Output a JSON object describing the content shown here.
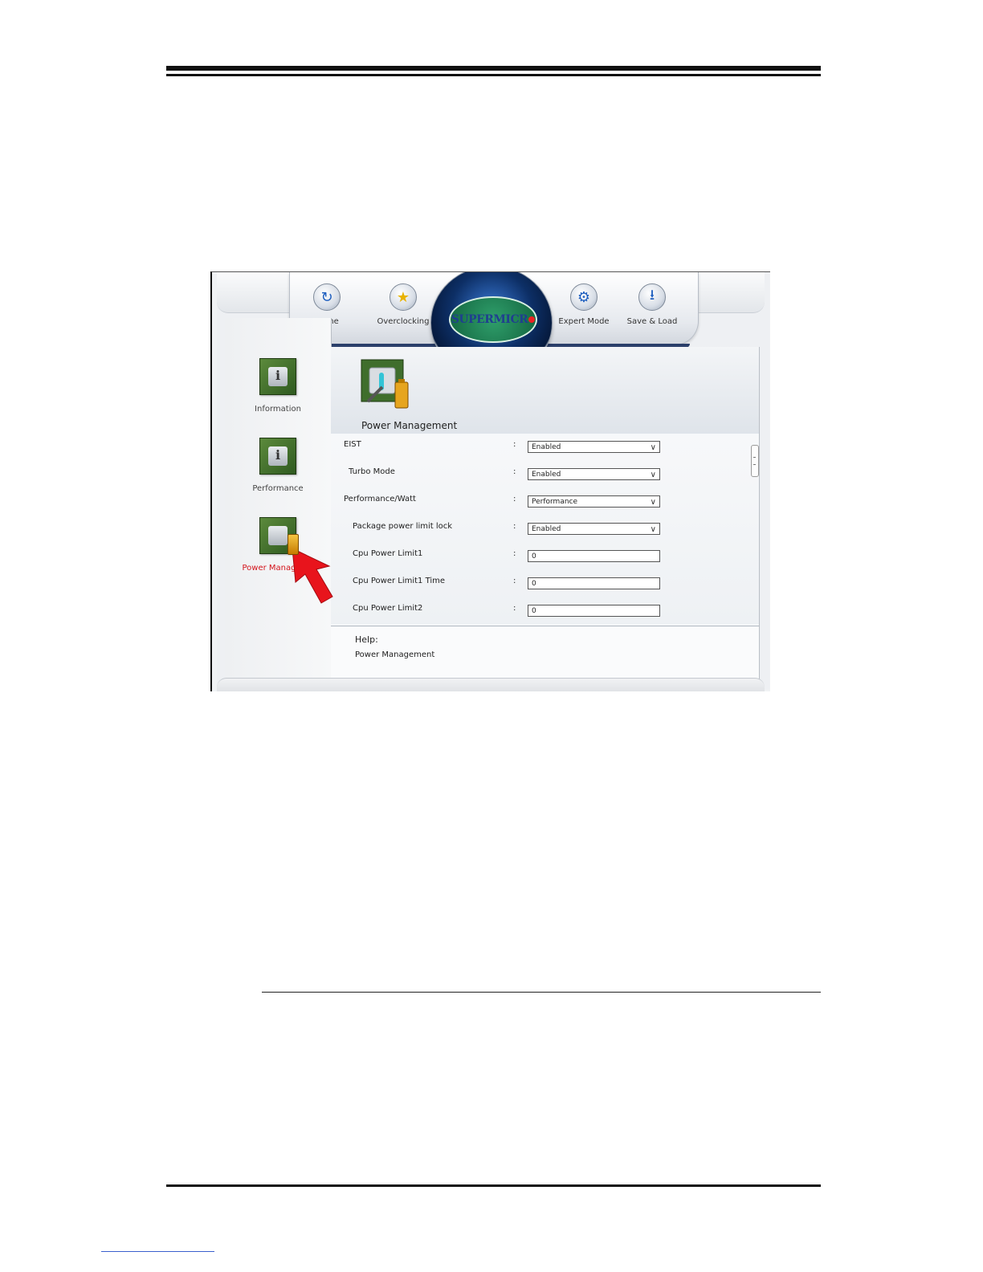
{
  "nav": {
    "home_label": "Home",
    "overclocking_label": "Overclocking",
    "expert_mode_label": "Expert Mode",
    "save_load_label": "Save & Load",
    "logo_text": "SUPERMICR"
  },
  "sidebar": {
    "items": [
      {
        "label": "Information"
      },
      {
        "label": "Performance"
      },
      {
        "label": "Power Manageme"
      }
    ]
  },
  "main": {
    "title": "Power Management",
    "settings": [
      {
        "label": "EIST",
        "value": "Enabled",
        "type": "dropdown"
      },
      {
        "label": "Turbo Mode",
        "value": "Enabled",
        "type": "dropdown"
      },
      {
        "label": "Performance/Watt",
        "value": "Performance",
        "type": "dropdown"
      },
      {
        "label": "Package power limit lock",
        "value": "Enabled",
        "type": "dropdown"
      },
      {
        "label": "Cpu Power Limit1",
        "value": "0",
        "type": "input"
      },
      {
        "label": "Cpu Power Limit1 Time",
        "value": "0",
        "type": "input"
      },
      {
        "label": "Cpu Power Limit2",
        "value": "0",
        "type": "input"
      }
    ],
    "colon": ":",
    "help_title": "Help:",
    "help_text": "Power Management"
  },
  "colors": {
    "active_item": "#d4141b",
    "arrow": "#e8141c",
    "logo_green": "#13643f"
  },
  "icons": {
    "home": "refresh-icon",
    "overclocking": "star-icon",
    "expert_mode": "gear-icon",
    "save_load": "download-icon"
  }
}
